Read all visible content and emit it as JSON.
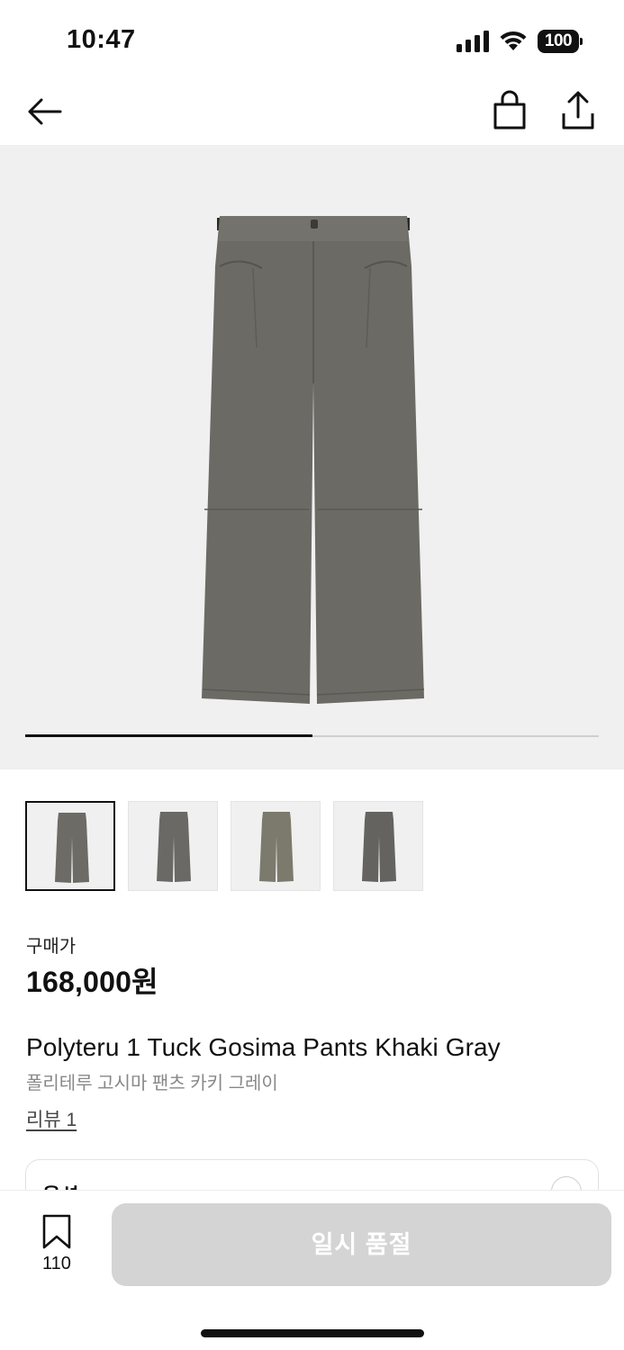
{
  "status_bar": {
    "time": "10:47",
    "battery": "100",
    "icons": [
      "signal-icon",
      "wifi-icon",
      "battery-icon"
    ]
  },
  "nav": {
    "icons": [
      "back-arrow-icon",
      "shopping-bag-icon",
      "share-icon"
    ]
  },
  "gallery": {
    "image_count": 4,
    "progress_fraction": 0.5,
    "thumbnail_colors": [
      "#6c6b66",
      "#6a6965",
      "#7b7a6d",
      "#64635f"
    ]
  },
  "product": {
    "price_label": "구매가",
    "price": "168,000원",
    "name_en": "Polyteru 1 Tuck Gosima Pants Khaki Gray",
    "name_ko": "폴리테루 고시마 팬츠 카키 그레이",
    "reviews": "리뷰 1"
  },
  "options": {
    "label": "옵션"
  },
  "bottom": {
    "wish_count": "110",
    "cta_label": "일시 품절"
  },
  "colors": {
    "image_bg": "#f0f0f0",
    "pants": "#6b6a65",
    "cta_disabled": "#d4d4d4"
  }
}
